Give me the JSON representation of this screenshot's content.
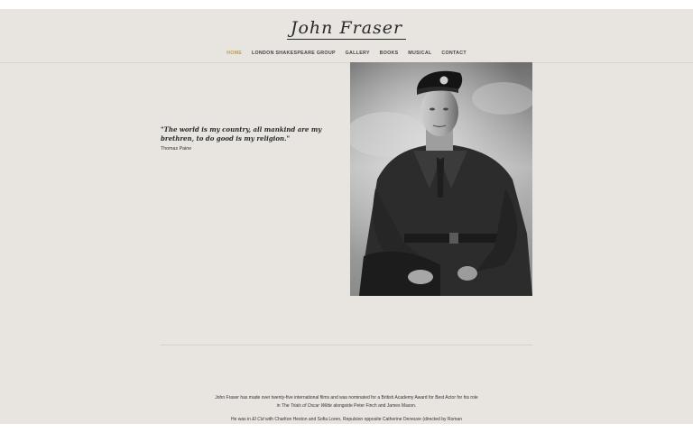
{
  "site": {
    "title": "John Fraser"
  },
  "nav": {
    "items": [
      {
        "label": "HOME"
      },
      {
        "label": "LONDON SHAKESPEARE GROUP"
      },
      {
        "label": "GALLERY"
      },
      {
        "label": "BOOKS"
      },
      {
        "label": "MUSICAL"
      },
      {
        "label": "CONTACT"
      }
    ]
  },
  "quote": {
    "text": "\"The world is my country, all mankind are my brethren, to do good is my religion.\"",
    "author": "Thomas Paine"
  },
  "bio": {
    "p1_a": "John Fraser has made over twenty-five international films and was nominated for a British Academy Award for Best Actor for his role in ",
    "p1_film": "The Trials of Oscar Wilde",
    "p1_b": " alongside Peter Finch and James Mason.",
    "p2_a": "He was in ",
    "p2_film": "El Cid",
    "p2_b": " with Charlton Heston and Sofia Loren, Repulsion opposite Catherine Deneuve (directed by Roman"
  },
  "colors": {
    "background": "#e8e5e1",
    "nav_active": "#b89a5a",
    "text": "#2a2a2a"
  }
}
